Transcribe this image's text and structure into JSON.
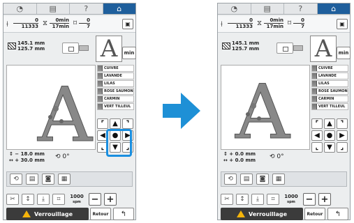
{
  "tabs": [
    {
      "icon": "clock-icon",
      "glyph": "◔"
    },
    {
      "icon": "document-icon",
      "glyph": "▤"
    },
    {
      "icon": "help-icon",
      "glyph": "?"
    },
    {
      "icon": "home-icon",
      "glyph": "⌂"
    }
  ],
  "counters": {
    "stitch_now": "0",
    "stitch_total": "11333",
    "time_now": "0min",
    "time_total": "17min",
    "color_now": "0",
    "color_total": "7"
  },
  "size": {
    "height": "145.1 mm",
    "width": "125.7 mm"
  },
  "min_label": "min",
  "thread_colors": [
    "CUIVRE",
    "LAVANDE",
    "LILAS",
    "ROSE SAUMON",
    "CARMIN",
    "VERT TILLEUL"
  ],
  "screens": [
    {
      "pos_y": "↕ − 18.0 mm",
      "pos_x": "↔ + 30.0 mm",
      "rotation": "0°"
    },
    {
      "pos_y": "↕ +  0.0 mm",
      "pos_x": "↔ +  0.0 mm",
      "rotation": "0°"
    }
  ],
  "speed": {
    "value": "1000",
    "unit": "spm"
  },
  "buttons": {
    "lock": "Verrouillage",
    "retour": "Retour",
    "minus": "−",
    "plus": "+"
  },
  "arrow_glyphs": [
    "⌜",
    "▲",
    "⌝",
    "◀",
    "●",
    "▶",
    "⌞",
    "▼",
    "⌟"
  ],
  "colors": {
    "highlight": "#1a8fe0",
    "arrow": "#1e90d6",
    "active_tab": "#1f5f9c"
  }
}
